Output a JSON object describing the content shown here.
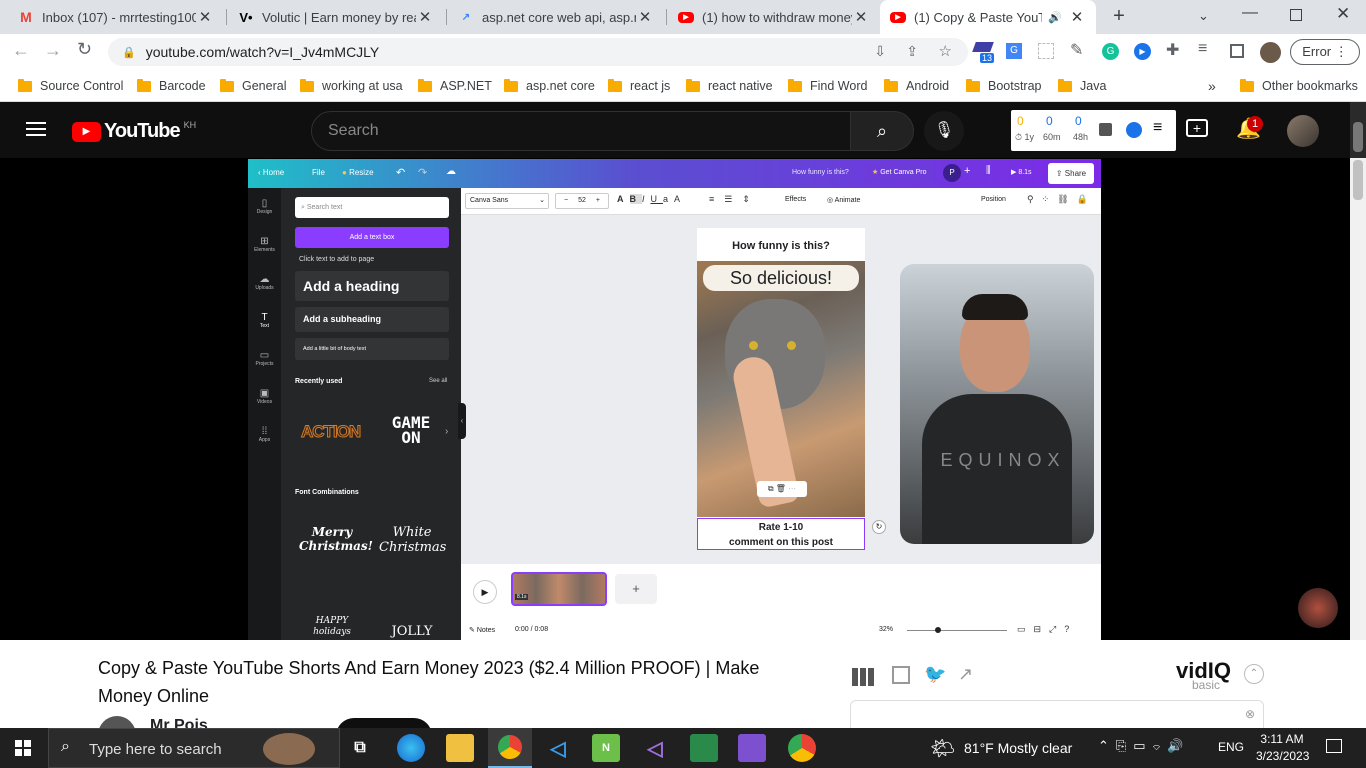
{
  "tabs": [
    {
      "title": "Inbox (107) - mrrtesting100@",
      "icon": "gmail-icon"
    },
    {
      "title": "Volutic | Earn money by readi",
      "icon": "volutic-icon"
    },
    {
      "title": "asp.net core web api, asp.net",
      "icon": "trend-icon"
    },
    {
      "title": "(1) how to withdraw money f",
      "icon": "youtube-icon"
    },
    {
      "title": "(1) Copy & Paste YouTub",
      "icon": "youtube-icon"
    }
  ],
  "new_tab_label": "+",
  "address": {
    "url": "youtube.com/watch?v=I_Jv4mMCJLY"
  },
  "extensions": {
    "badge_count": "13",
    "profile_label": "Error"
  },
  "bookmarks": [
    "Source Control",
    "Barcode",
    "General",
    "working at usa",
    "ASP.NET",
    "asp.net core",
    "react js",
    "react native",
    "Find Word",
    "Android",
    "Bootstrap",
    "Java"
  ],
  "bookmarks_overflow": "»",
  "other_bookmarks": "Other bookmarks",
  "youtube": {
    "logo_text": "YouTube",
    "country_code": "KH",
    "search_placeholder": "Search",
    "vidiq_stats": {
      "v1": "0",
      "v1_label": "1y",
      "v2": "0",
      "v2_label": "60m",
      "v3": "0",
      "v3_label": "48h"
    },
    "notification_count": "1"
  },
  "canva": {
    "home": "Home",
    "file": "File",
    "resize": "Resize",
    "doc_title": "How funny is this?",
    "get_pro": "Get Canva Pro",
    "avatar": "P",
    "duration": "8.1s",
    "share": "Share",
    "sidebar": [
      "Design",
      "Elements",
      "Uploads",
      "Text",
      "Projects",
      "Videos",
      "Apps"
    ],
    "search_text": "Search text",
    "add_text_box": "Add a text box",
    "click_text": "Click text to add to page",
    "heading": "Add a heading",
    "subheading": "Add a subheading",
    "body": "Add a little bit of body text",
    "recently_used": "Recently used",
    "see_all": "See all",
    "recent": [
      "ACTION",
      "GAME ON"
    ],
    "font_combos": "Font Combinations",
    "combos": [
      "Merry Christmas!",
      "White Christmas",
      "HAPPY holidays",
      "JOLLY"
    ],
    "font": "Canva Sans",
    "font_size": "52",
    "effects": "Effects",
    "animate": "Animate",
    "position": "Position",
    "page_title": "How funny is this?",
    "overlay_text": "So delicious!",
    "caption_line1": "Rate 1-10",
    "caption_line2": "comment on this post",
    "shirt_text": "EQUINOX",
    "clip_duration": "8.1s",
    "notes": "Notes",
    "time": "0:00 / 0:08",
    "zoom": "32%"
  },
  "video": {
    "title": "Copy & Paste YouTube Shorts And Earn Money 2023 ($2.4 Million PROOF) | Make Money Online",
    "channel": "Mr Pois",
    "vidiq_brand": "vidIQ",
    "vidiq_plan": "basic"
  },
  "taskbar": {
    "search_placeholder": "Type here to search",
    "weather": "81°F  Mostly clear",
    "lang": "ENG",
    "time": "3:11 AM",
    "date": "3/23/2023"
  }
}
